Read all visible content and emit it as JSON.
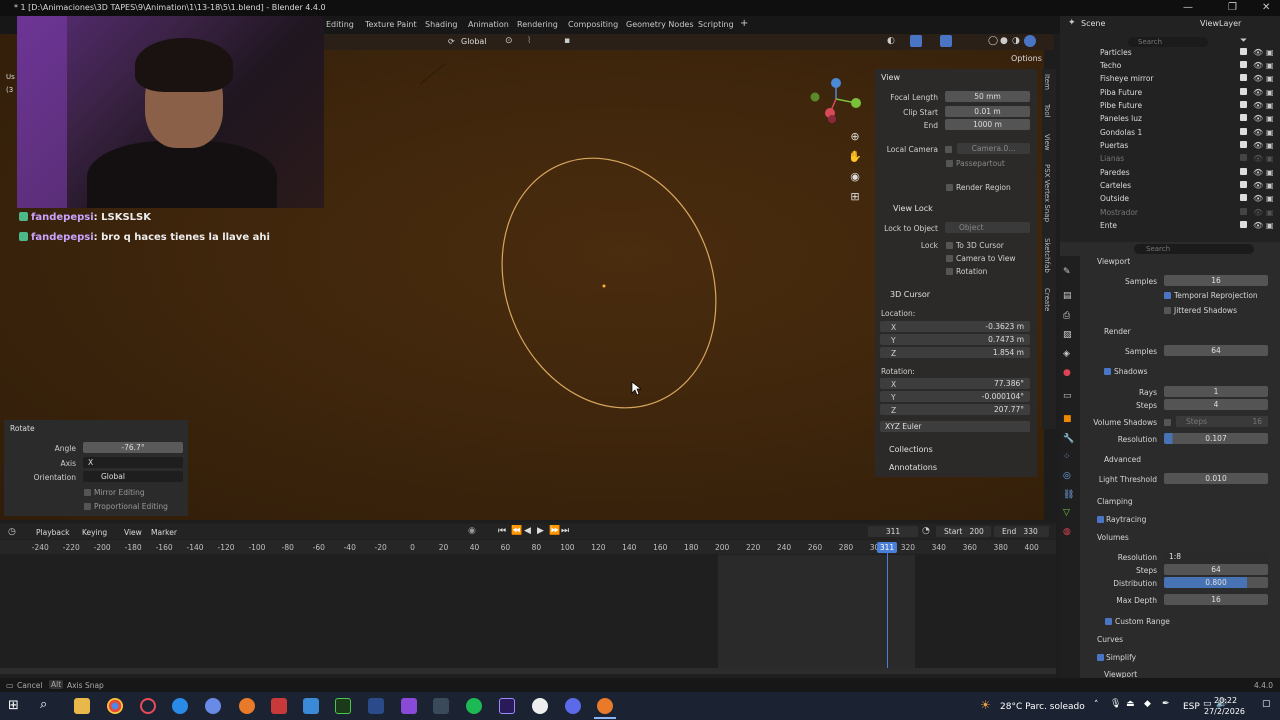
{
  "window": {
    "title": "* 1 [D:\\Animaciones\\3D TAPES\\9\\Animation\\1\\13-18\\5\\1.blend] - Blender 4.4.0",
    "minimize": "—",
    "maximize": "❐",
    "close": "✕"
  },
  "workspaces": [
    "Editing",
    "Texture Paint",
    "Shading",
    "Animation",
    "Rendering",
    "Compositing",
    "Geometry Nodes",
    "Scripting",
    "+"
  ],
  "header": {
    "orientation": "Global",
    "options": "Options"
  },
  "chat": [
    {
      "user": "fandepepsi",
      "msg": ": LSKSLSK"
    },
    {
      "user": "fandepepsi",
      "msg": ": bro q haces tienes la llave ahi"
    }
  ],
  "left_overlay": {
    "a": "Us",
    "b": "(3"
  },
  "npanel": {
    "view_title": "View",
    "focal_length_label": "Focal Length",
    "focal_length": "50 mm",
    "clip_start_label": "Clip Start",
    "clip_start": "0.01 m",
    "end_label": "End",
    "end": "1000 m",
    "local_camera_label": "Local Camera",
    "local_camera": "Camera.0...",
    "passepartout": "Passepartout",
    "render_region": "Render Region",
    "view_lock_title": "View Lock",
    "lock_to_object_label": "Lock to Object",
    "lock_to_object": "Object",
    "lock_label": "Lock",
    "to_3d_cursor": "To 3D Cursor",
    "camera_to_view": "Camera to View",
    "rotation": "Rotation",
    "cursor_title": "3D Cursor",
    "location_label": "Location:",
    "loc_x": "-0.3623 m",
    "loc_y": "0.7473 m",
    "loc_z": "1.854 m",
    "rotation_label": "Rotation:",
    "rot_x": "77.386°",
    "rot_y": "-0.000104°",
    "rot_z": "207.77°",
    "rot_mode": "XYZ Euler",
    "collections": "Collections",
    "annotations": "Annotations",
    "x": "X",
    "y": "Y",
    "z": "Z"
  },
  "vtabs": [
    "Item",
    "Tool",
    "View",
    "PSX Vertex Snap",
    "Sketchfab",
    "Create"
  ],
  "rotate_panel": {
    "title": "Rotate",
    "angle_label": "Angle",
    "angle": "-76.7°",
    "axis_label": "Axis",
    "axis": "X",
    "orientation_label": "Orientation",
    "orientation": "Global",
    "mirror": "Mirror Editing",
    "proportional": "Proportional Editing"
  },
  "outliner": {
    "scene": "Scene",
    "view_layer": "ViewLayer",
    "search": "Search",
    "items": [
      {
        "name": "Particles",
        "disabled": false
      },
      {
        "name": "Techo",
        "disabled": false
      },
      {
        "name": "Fisheye mirror",
        "disabled": false
      },
      {
        "name": "Piba Future",
        "disabled": false
      },
      {
        "name": "Pibe Future",
        "disabled": false
      },
      {
        "name": "Paneles luz",
        "disabled": false
      },
      {
        "name": "Gondolas 1",
        "disabled": false
      },
      {
        "name": "Puertas",
        "disabled": false
      },
      {
        "name": "Lianas",
        "disabled": true
      },
      {
        "name": "Paredes",
        "disabled": false
      },
      {
        "name": "Carteles",
        "disabled": false
      },
      {
        "name": "Outside",
        "disabled": false
      },
      {
        "name": "Mostrador",
        "disabled": true
      },
      {
        "name": "Ente",
        "disabled": false
      }
    ]
  },
  "props": {
    "search": "Search",
    "viewport": "Viewport",
    "samples_label": "Samples",
    "viewport_samples": "16",
    "temporal_reprojection": "Temporal Reprojection",
    "jittered_shadows": "Jittered Shadows",
    "render": "Render",
    "render_samples": "64",
    "shadows": "Shadows",
    "rays_label": "Rays",
    "rays": "1",
    "steps_label": "Steps",
    "steps": "4",
    "volume_shadows_label": "Volume Shadows",
    "volume_shadows_steps_label": "Steps",
    "volume_shadows_steps": "16",
    "resolution_label": "Resolution",
    "resolution": "0.107",
    "advanced": "Advanced",
    "light_threshold_label": "Light Threshold",
    "light_threshold": "0.010",
    "clamping": "Clamping",
    "raytracing": "Raytracing",
    "volumes": "Volumes",
    "vol_resolution": "1:8",
    "vol_steps": "64",
    "distribution_label": "Distribution",
    "distribution": "0.800",
    "max_depth_label": "Max Depth",
    "max_depth": "16",
    "custom_range": "Custom Range",
    "curves": "Curves",
    "simplify": "Simplify",
    "viewport2": "Viewport"
  },
  "timeline": {
    "playback": "Playback",
    "keying": "Keying",
    "view": "View",
    "marker": "Marker",
    "current_frame": "311",
    "start_label": "Start",
    "start": "200",
    "end_label": "End",
    "end": "330",
    "ticks": [
      "-240",
      "-220",
      "-200",
      "-180",
      "-160",
      "-140",
      "-120",
      "-100",
      "-80",
      "-60",
      "-40",
      "-20",
      "0",
      "20",
      "40",
      "60",
      "80",
      "100",
      "120",
      "140",
      "160",
      "180",
      "200",
      "220",
      "240",
      "260",
      "280",
      "300",
      "320",
      "340",
      "360",
      "380",
      "400"
    ],
    "playhead": "311"
  },
  "statusbar": {
    "cancel": "Cancel",
    "alt": "Alt",
    "axis_snap": "Axis Snap",
    "version": "4.4.0"
  },
  "taskbar": {
    "weather": "28°C  Parc. soleado",
    "lang": "ESP",
    "time": "20:22",
    "date": "27/2/2026"
  }
}
